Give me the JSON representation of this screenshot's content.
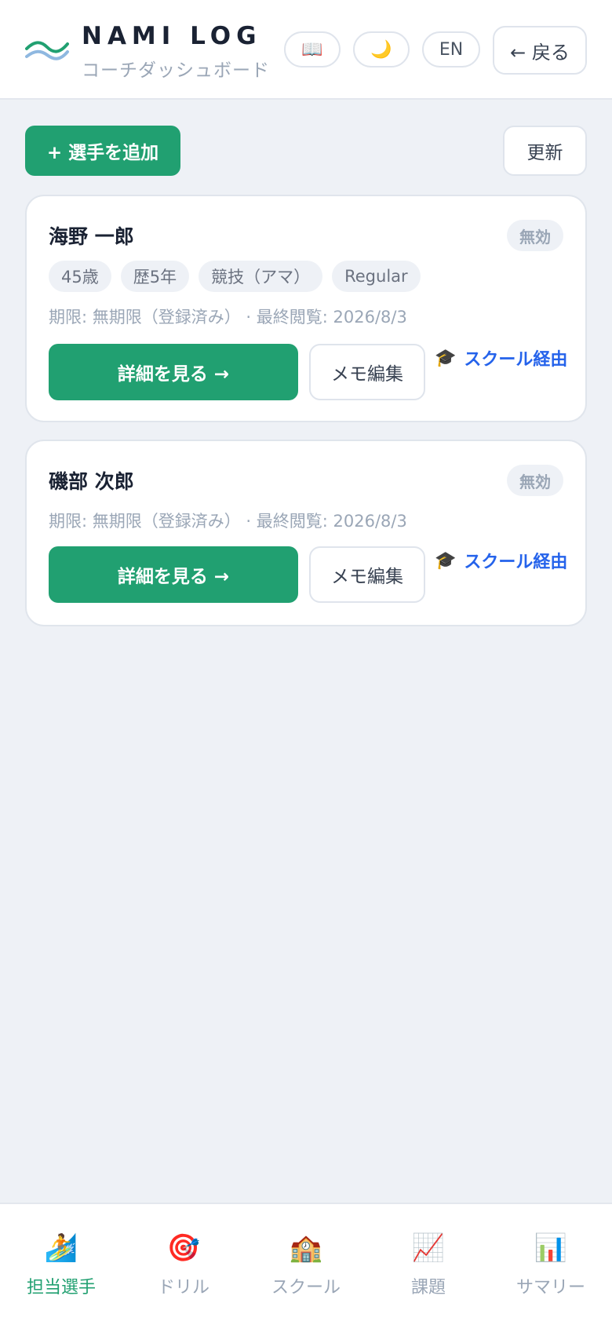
{
  "header": {
    "title": "NAMI LOG",
    "subtitle": "コーチダッシュボード",
    "guide_icon": "📖",
    "theme_icon": "🌙",
    "lang_label": "EN",
    "back_label": "← 戻る"
  },
  "toolbar": {
    "add_label": "+ 選手を追加",
    "refresh_label": "更新"
  },
  "athletes": [
    {
      "name": "海野 一郎",
      "status": "無効",
      "tags": [
        "45歳",
        "歴5年",
        "競技（アマ）",
        "Regular"
      ],
      "meta": "期限: 無期限（登録済み） · 最終閲覧: 2026/8/3",
      "detail_label": "詳細を見る →",
      "memo_label": "メモ編集",
      "school_icon": "🎓",
      "school_label": "スクール経由"
    },
    {
      "name": "磯部 次郎",
      "status": "無効",
      "tags": [],
      "meta": "期限: 無期限（登録済み） · 最終閲覧: 2026/8/3",
      "detail_label": "詳細を見る →",
      "memo_label": "メモ編集",
      "school_icon": "🎓",
      "school_label": "スクール経由"
    }
  ],
  "bottom_nav": [
    {
      "icon": "🏄",
      "label": "担当選手",
      "active": true
    },
    {
      "icon": "🎯",
      "label": "ドリル",
      "active": false
    },
    {
      "icon": "🏫",
      "label": "スクール",
      "active": false
    },
    {
      "icon": "📈",
      "label": "課題",
      "active": false
    },
    {
      "icon": "📊",
      "label": "サマリー",
      "active": false
    }
  ],
  "colors": {
    "accent": "#21a071",
    "link": "#2563eb",
    "background": "#eef1f6"
  }
}
